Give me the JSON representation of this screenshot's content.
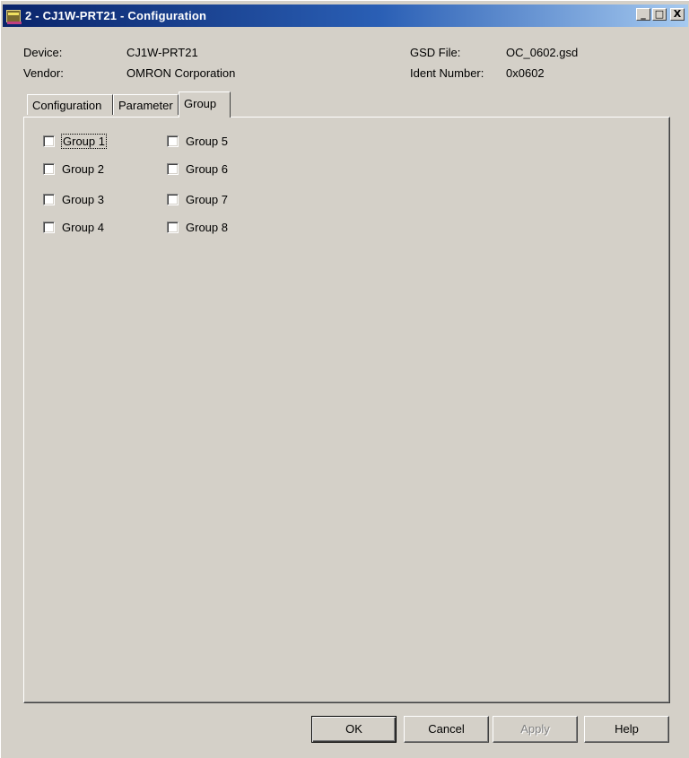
{
  "window": {
    "title": "2 - CJ1W-PRT21 - Configuration",
    "controls": {
      "minimize": "_",
      "maximize": "□",
      "close": "X"
    }
  },
  "info": {
    "device_label": "Device:",
    "device_value": "CJ1W-PRT21",
    "vendor_label": "Vendor:",
    "vendor_value": "OMRON Corporation",
    "gsd_label": "GSD File:",
    "gsd_value": "OC_0602.gsd",
    "ident_label": "Ident Number:",
    "ident_value": "0x0602"
  },
  "tabs": [
    {
      "label": "Configuration",
      "active": false
    },
    {
      "label": "Parameter",
      "active": false
    },
    {
      "label": "Group",
      "active": true
    }
  ],
  "groups": [
    {
      "label": "Group 1",
      "checked": false,
      "focused": true
    },
    {
      "label": "Group 2",
      "checked": false
    },
    {
      "label": "Group 3",
      "checked": false
    },
    {
      "label": "Group 4",
      "checked": false
    },
    {
      "label": "Group 5",
      "checked": false
    },
    {
      "label": "Group 6",
      "checked": false
    },
    {
      "label": "Group 7",
      "checked": false
    },
    {
      "label": "Group 8",
      "checked": false
    }
  ],
  "buttons": {
    "ok": "OK",
    "cancel": "Cancel",
    "apply": "Apply",
    "help": "Help"
  },
  "colors": {
    "titlebar_start": "#0a246a",
    "titlebar_end": "#a6caf0",
    "face": "#d4d0c8"
  }
}
